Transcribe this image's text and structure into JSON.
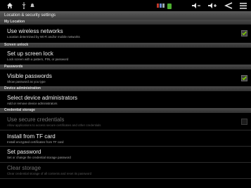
{
  "status_bar": {
    "icons": [
      "home-icon",
      "usb-icon",
      "notification-icon",
      "storage-icon",
      "wifi-icon",
      "volume-down-icon",
      "volume-up-icon",
      "back-icon",
      "menu-icon"
    ]
  },
  "title": "Location & security settings",
  "sections": {
    "my_location": "My Location",
    "screen_unlock": "Screen unlock",
    "passwords": "Passwords",
    "device_admin": "Device administration",
    "credential_storage": "Credential storage"
  },
  "items": {
    "wireless": {
      "title": "Use wireless networks",
      "summary": "Location determined by Wi-Fi and/or mobile networks",
      "checked": true
    },
    "screen_lock": {
      "title": "Set up screen lock",
      "summary": "Lock screen with a pattern, PIN, or password"
    },
    "visible_passwords": {
      "title": "Visible passwords",
      "summary": "Show password as you type",
      "checked": true
    },
    "device_admins": {
      "title": "Select device administrators",
      "summary": "Add or remove device administrators"
    },
    "secure_credentials": {
      "title": "Use secure credentials",
      "summary": "Allow applications to access secure certificates and other credentials",
      "checked": false,
      "enabled": false
    },
    "install_tf": {
      "title": "Install from TF card",
      "summary": "Install encrypted certificates from TF card"
    },
    "set_password": {
      "title": "Set password",
      "summary": "Set or change the credential storage password"
    },
    "clear_storage": {
      "title": "Clear storage",
      "summary": "Clear credential storage of all contents and reset its password",
      "enabled": false
    }
  },
  "colors": {
    "check_green": "#7ccf00",
    "background": "#000000"
  }
}
